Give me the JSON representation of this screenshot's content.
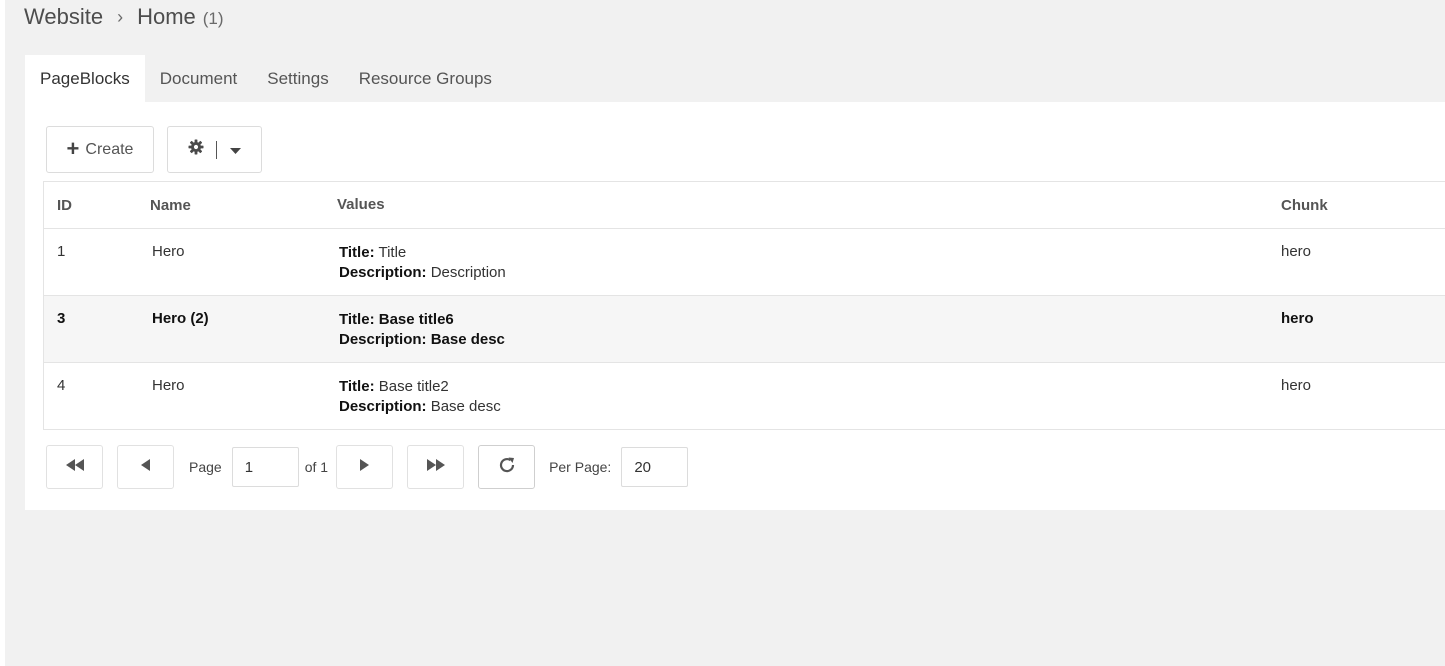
{
  "breadcrumb": {
    "root": "Website",
    "separator": "›",
    "current": "Home",
    "count": "(1)"
  },
  "tabs": [
    {
      "label": "PageBlocks",
      "active": true
    },
    {
      "label": "Document",
      "active": false
    },
    {
      "label": "Settings",
      "active": false
    },
    {
      "label": "Resource Groups",
      "active": false
    }
  ],
  "toolbar": {
    "create_label": "Create",
    "settings_icon": "gear-icon",
    "dropdown_icon": "caret-down-icon"
  },
  "grid": {
    "columns": {
      "id": "ID",
      "name": "Name",
      "values": "Values",
      "chunk": "Chunk"
    },
    "rows": [
      {
        "id": "1",
        "name": "Hero",
        "title_label": "Title:",
        "title": "Title",
        "desc_label": "Description:",
        "desc": "Description",
        "chunk": "hero",
        "selected": false
      },
      {
        "id": "3",
        "name": "Hero (2)",
        "title_label": "Title:",
        "title": "Base title6",
        "desc_label": "Description:",
        "desc": "Base desc",
        "chunk": "hero",
        "selected": true
      },
      {
        "id": "4",
        "name": "Hero",
        "title_label": "Title:",
        "title": "Base title2",
        "desc_label": "Description:",
        "desc": "Base desc",
        "chunk": "hero",
        "selected": false
      }
    ]
  },
  "pager": {
    "page_label": "Page",
    "page_value": "1",
    "of_label": "of 1",
    "per_page_label": "Per Page:",
    "per_page_value": "20"
  },
  "colors": {
    "background": "#f1f1f1",
    "panel": "#ffffff",
    "selected_row": "#f6f6f6",
    "border": "#e4e4e4"
  }
}
